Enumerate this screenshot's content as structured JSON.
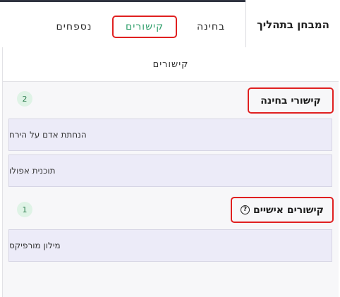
{
  "header": {
    "exam_title": "המבחן בתהליך",
    "tabs": [
      {
        "label": "בחינה",
        "active": false
      },
      {
        "label": "קישורים",
        "active": true
      },
      {
        "label": "נספחים",
        "active": false
      }
    ]
  },
  "panel": {
    "title": "קישורים",
    "sections": [
      {
        "title": "קישורי בחינה",
        "count": "2",
        "items": [
          "הנחתת אדם על הירח",
          "תוכנית אפולו"
        ]
      },
      {
        "title": "קישורים אישיים",
        "help_icon": "?",
        "count": "1",
        "items": [
          "מילון מורפיקס"
        ]
      }
    ]
  },
  "colors": {
    "active_tab": "#2e9e6a",
    "highlight_border": "#e02020",
    "link_item_bg": "#ecebf8",
    "badge_bg": "#dff3e6",
    "topbar": "#2f3340"
  },
  "icons": [
    "help-circle-icon"
  ]
}
